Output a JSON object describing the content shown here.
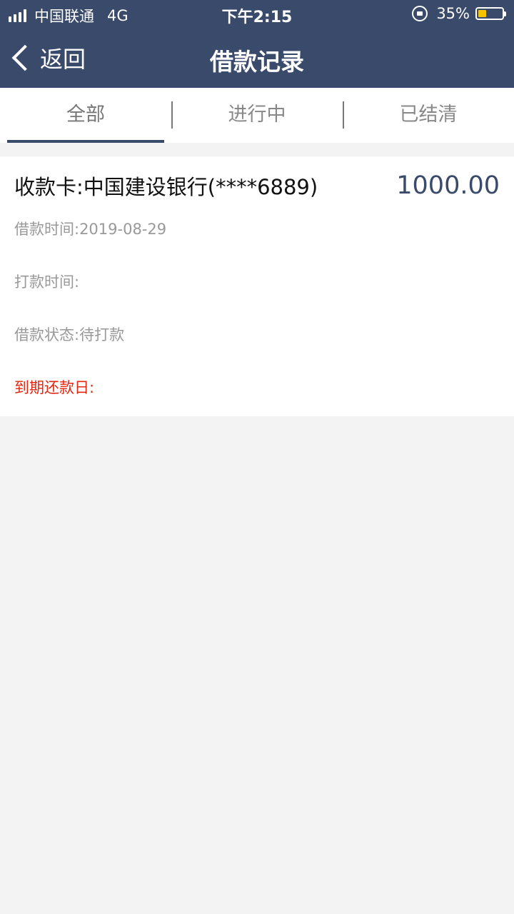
{
  "status_bar": {
    "carrier": "中国联通",
    "network": "4G",
    "time": "下午2:15",
    "battery_percent": "35%",
    "battery_level": 0.35,
    "signal_bars": 4
  },
  "nav": {
    "back_label": "返回",
    "title": "借款记录"
  },
  "tabs": [
    {
      "label": "全部",
      "active": true
    },
    {
      "label": "进行中",
      "active": false
    },
    {
      "label": "已结清",
      "active": false
    }
  ],
  "records": [
    {
      "card_label": "收款卡:中国建设银行(****6889)",
      "amount": "1000.00",
      "loan_time": "借款时间:2019-08-29",
      "payment_time": "打款时间:",
      "loan_status": "借款状态:待打款",
      "due_date": "到期还款日:"
    }
  ],
  "colors": {
    "header_bg": "#3a4a6b",
    "accent": "#3a4a6b",
    "due_date_red": "#e2260f",
    "battery_fill": "#f5c400",
    "page_bg": "#f3f3f3"
  }
}
